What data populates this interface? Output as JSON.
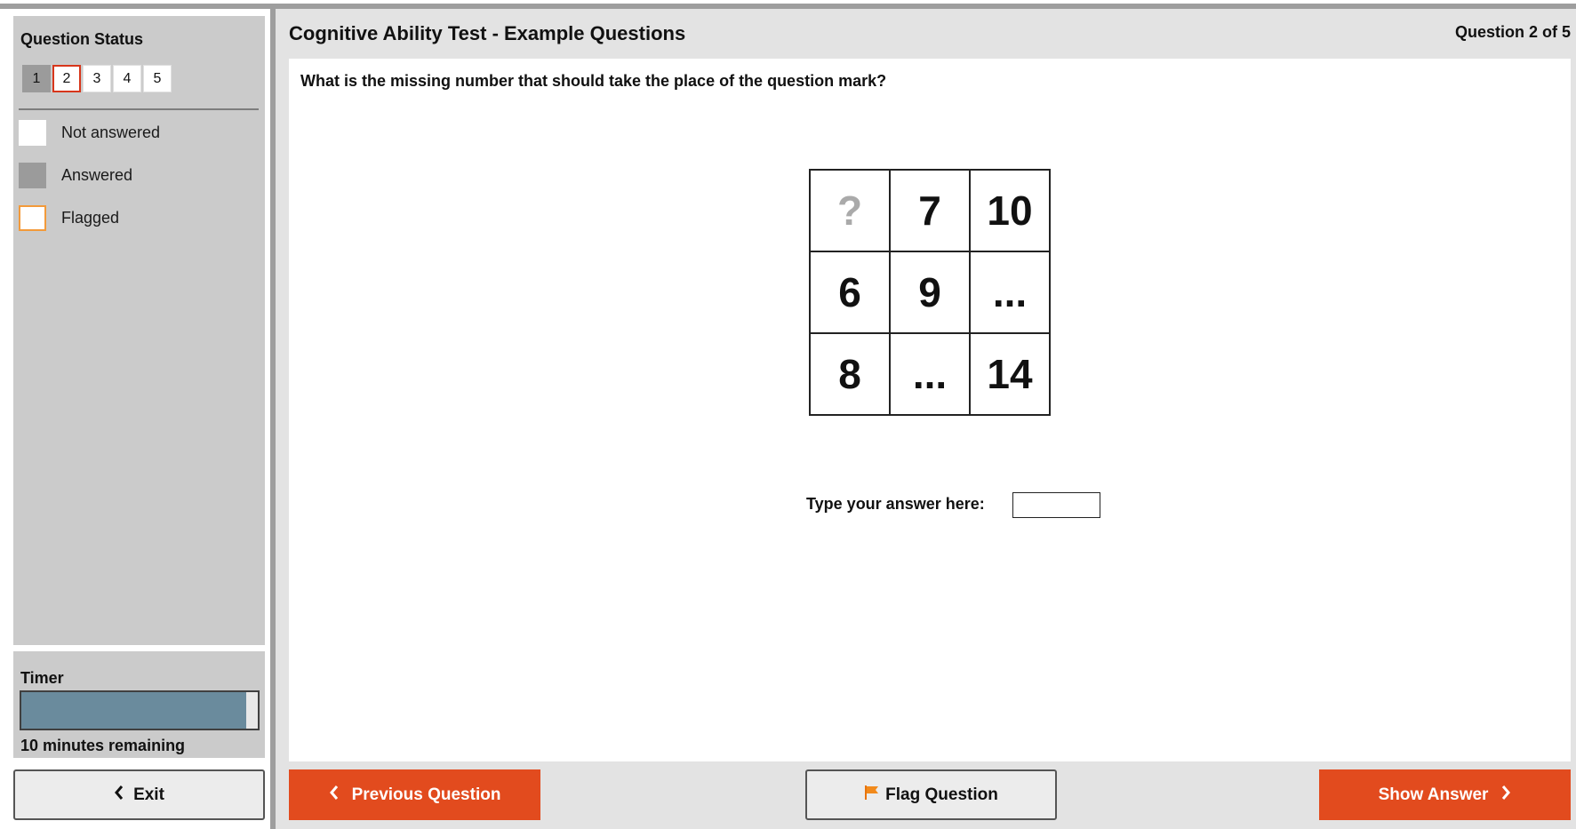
{
  "sidebar": {
    "status_title": "Question Status",
    "questions": [
      {
        "label": "1",
        "state": "answered"
      },
      {
        "label": "2",
        "state": "current"
      },
      {
        "label": "3",
        "state": "not-answered"
      },
      {
        "label": "4",
        "state": "not-answered"
      },
      {
        "label": "5",
        "state": "not-answered"
      }
    ],
    "legend": {
      "not_answered": "Not answered",
      "answered": "Answered",
      "flagged": "Flagged"
    },
    "timer": {
      "title": "Timer",
      "remaining_text": "10 minutes remaining",
      "progress_fraction": 0.95
    },
    "exit_label": "Exit"
  },
  "header": {
    "title": "Cognitive Ability Test - Example Questions",
    "counter": "Question 2 of 5"
  },
  "question": {
    "text": "What is the missing number that should take the place of the question mark?",
    "grid": [
      [
        "?",
        "7",
        "10"
      ],
      [
        "6",
        "9",
        "..."
      ],
      [
        "8",
        "...",
        "14"
      ]
    ],
    "answer_label": "Type your answer here:",
    "answer_value": ""
  },
  "footer": {
    "previous_label": "Previous Question",
    "flag_label": "Flag Question",
    "show_answer_label": "Show Answer"
  },
  "colors": {
    "accent": "#e24b1e",
    "answered": "#9b9b9b",
    "flagged": "#f39a3a",
    "timer_fill": "#6a8b9d"
  },
  "icons": {
    "exit": "chevron-left-icon",
    "previous": "chevron-left-icon",
    "flag": "flag-icon",
    "show_answer": "chevron-right-icon"
  }
}
